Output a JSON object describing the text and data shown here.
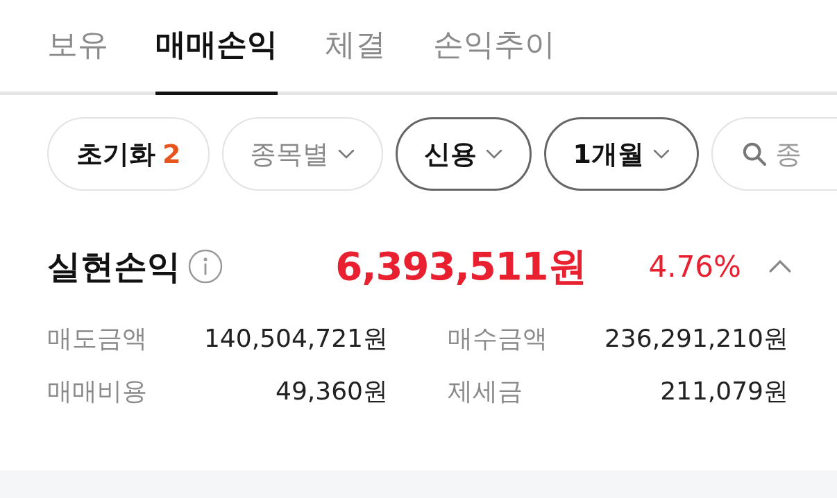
{
  "tabs": [
    {
      "label": "보유",
      "selected": false
    },
    {
      "label": "매매손익",
      "selected": true
    },
    {
      "label": "체결",
      "selected": false
    },
    {
      "label": "손익추이",
      "selected": false
    }
  ],
  "filters": [
    {
      "kind": "reset",
      "label": "초기화",
      "count": "2"
    },
    {
      "kind": "dropdown",
      "label": "종목별",
      "selected": false
    },
    {
      "kind": "dropdown",
      "label": "신용",
      "selected": true
    },
    {
      "kind": "dropdown",
      "label": "1개월",
      "selected": true
    },
    {
      "kind": "search",
      "placeholder": "종"
    }
  ],
  "summary": {
    "title": "실현손익",
    "amount": "6,393,511원",
    "rate": "4.76%",
    "expanded": true
  },
  "details": [
    {
      "label": "매도금액",
      "value": "140,504,721원"
    },
    {
      "label": "매수금액",
      "value": "236,291,210원"
    },
    {
      "label": "매매비용",
      "value": "49,360원"
    },
    {
      "label": "제세금",
      "value": "211,079원"
    }
  ]
}
